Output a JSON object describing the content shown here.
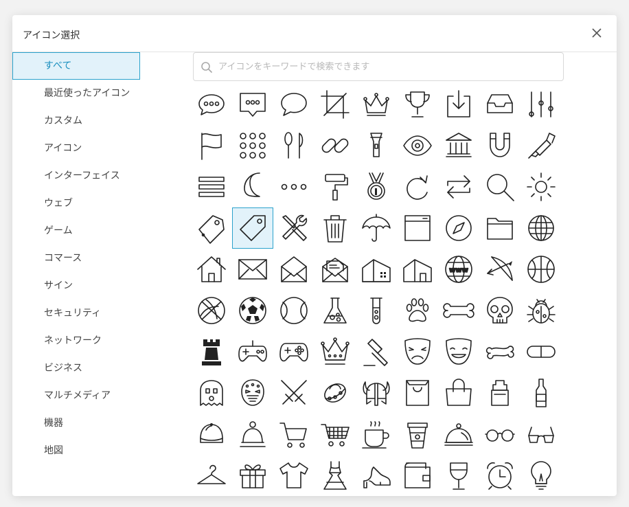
{
  "dialog": {
    "title": "アイコン選択",
    "close_icon": "close-icon"
  },
  "search": {
    "placeholder": "アイコンをキーワードで検索できます",
    "value": "",
    "icon": "search-icon"
  },
  "categories": [
    {
      "label": "すべて",
      "active": true
    },
    {
      "label": "最近使ったアイコン"
    },
    {
      "label": "カスタム"
    },
    {
      "label": "アイコン"
    },
    {
      "label": "インターフェイス"
    },
    {
      "label": "ウェブ"
    },
    {
      "label": "ゲーム"
    },
    {
      "label": "コマース"
    },
    {
      "label": "サイン"
    },
    {
      "label": "セキュリティ"
    },
    {
      "label": "ネットワーク"
    },
    {
      "label": "ビジネス"
    },
    {
      "label": "マルチメディア"
    },
    {
      "label": "機器"
    },
    {
      "label": "地図"
    }
  ],
  "colors": {
    "accent": "#2aa2cc",
    "accent_bg": "#e2f2fa",
    "active_text": "#1a8fbf"
  },
  "icon_grid": {
    "selected_icon": "tag-icon",
    "icons": [
      "speech-bubble-dots-icon",
      "message-dots-icon",
      "speech-bubble-icon",
      "crop-icon",
      "crown-icon",
      "trophy-icon",
      "download-tray-icon",
      "inbox-icon",
      "sliders-icon",
      "flag-icon",
      "grid-dots-icon",
      "spoon-knife-icon",
      "link-icon",
      "flashlight-icon",
      "eye-icon",
      "bank-icon",
      "magnet-icon",
      "highlighter-icon",
      "menu-bars-icon",
      "moon-icon",
      "ellipsis-icon",
      "paint-roller-icon",
      "medal-icon",
      "redo-icon",
      "repeat-icon",
      "magnifier-icon",
      "sun-icon",
      "tag-outline-icon",
      "tag-icon",
      "tools-icon",
      "trash-icon",
      "umbrella-icon",
      "browser-window-icon",
      "compass-icon",
      "folder-icon",
      "globe-icon",
      "home-icon",
      "envelope-icon",
      "envelope-open-icon",
      "envelope-letter-icon",
      "building-icon",
      "warehouse-icon",
      "www-globe-icon",
      "bow-arrow-icon",
      "basketball-icon",
      "basketball-ball-icon",
      "soccer-ball-icon",
      "tennis-ball-icon",
      "flask-icon",
      "test-tube-icon",
      "paw-icon",
      "bone-icon",
      "skull-icon",
      "bug-icon",
      "chess-rook-icon",
      "gamepad-icon",
      "game-controller-icon",
      "king-crown-icon",
      "gavel-icon",
      "sad-mask-icon",
      "happy-mask-icon",
      "dog-bone-icon",
      "pill-icon",
      "ghost-icon",
      "hockey-mask-icon",
      "crossed-swords-icon",
      "ufo-icon",
      "viking-helmet-icon",
      "shopping-bag-icon",
      "handbag-icon",
      "water-jug-icon",
      "bottle-icon",
      "cap-icon",
      "bell-icon",
      "shopping-cart-icon",
      "shopping-basket-icon",
      "coffee-cup-icon",
      "takeaway-cup-icon",
      "cloche-icon",
      "round-glasses-icon",
      "sunglasses-icon",
      "hanger-icon",
      "gift-icon",
      "tshirt-icon",
      "dress-icon",
      "high-heel-icon",
      "wallet-icon",
      "wine-glass-icon",
      "alarm-clock-icon",
      "light-bulb-icon"
    ]
  }
}
